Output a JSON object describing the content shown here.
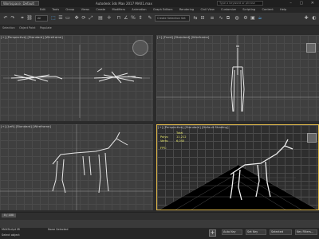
{
  "app": {
    "workspace_label": "Workspace: Default",
    "title": "Autodesk 3ds Max 2017    MAX1.max",
    "search_placeholder": "Type a keyword or phrase",
    "window_buttons": "–  ▢  ✕"
  },
  "menu": [
    "Edit",
    "Tools",
    "Group",
    "Views",
    "Create",
    "Modifiers",
    "Animation",
    "Graph Editors",
    "Rendering",
    "Civil View",
    "Customize",
    "Scripting",
    "Content",
    "Help"
  ],
  "toolbar": {
    "create_selection_set": "Create Selection Set",
    "selection_filter": "All"
  },
  "subbar": {
    "selection": "Selection",
    "paint": "Object Paint",
    "populate": "Populate"
  },
  "viewports": {
    "top_left": "[+] [Perspective] [Standard] [Wireframe]",
    "top_right": "[+] [Front] [Standard] [Wireframe]",
    "bottom_left": "[+] [Left] [Standard] [Wireframe]",
    "bottom_right": "[+] [Perspective] [Standard] [Default Shading]"
  },
  "stats": {
    "header": "Total",
    "polys_label": "Polys:",
    "polys_value": "11,212",
    "verts_label": "Verts:",
    "verts_value": "6,045",
    "fps_label": "FPS:"
  },
  "timeline": {
    "frame": "0 / 100"
  },
  "status": {
    "selected": "None Selected",
    "hint": "Select object",
    "script_label": "MAXScript Mi",
    "auto_key": "Auto Key",
    "selected_label": "Selected",
    "set_key": "Set Key",
    "key_filters": "Key Filters..."
  }
}
